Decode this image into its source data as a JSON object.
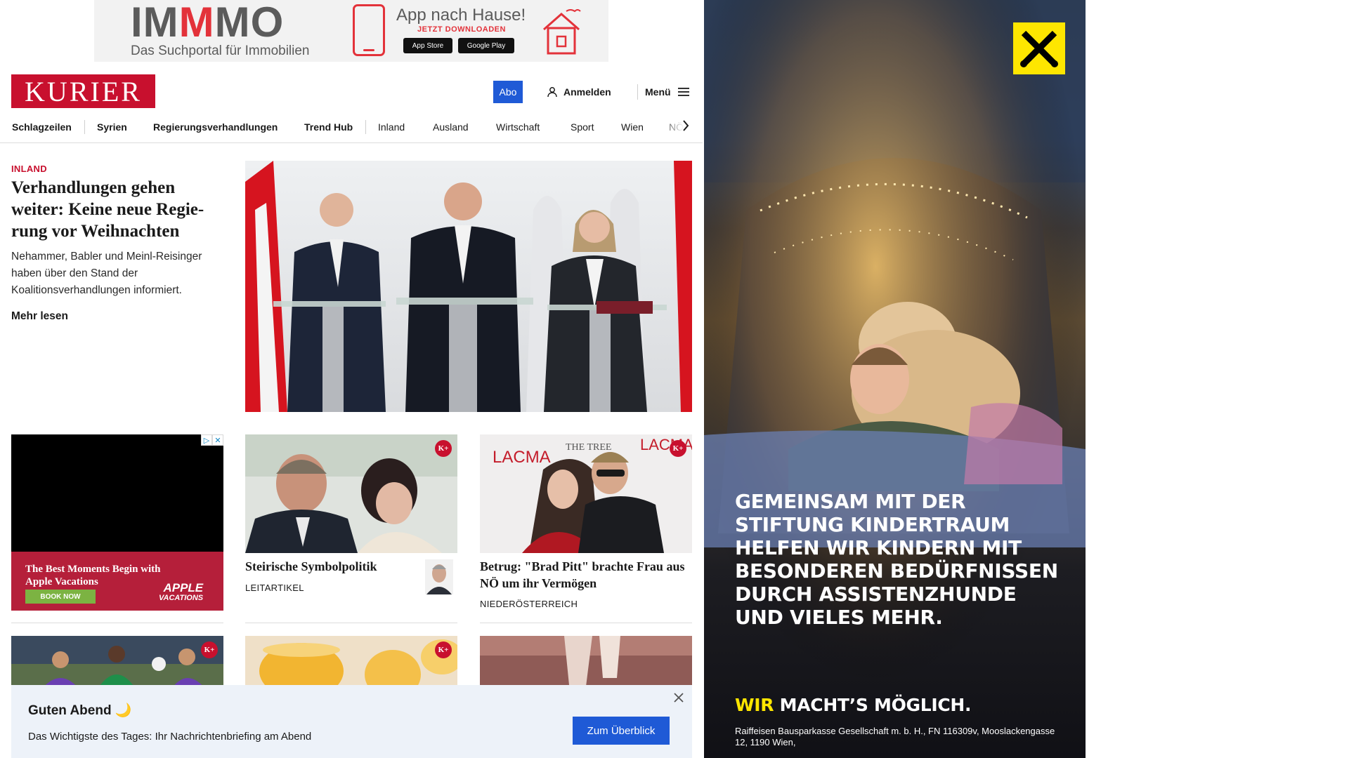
{
  "top_ad": {
    "brand_part1": "IM",
    "brand_part2": "M",
    "brand_part3": "MO",
    "subline": "Das Suchportal für Immobilien",
    "headline": "App nach Hause!",
    "cta": "JETZT DOWNLOADEN",
    "apple_store": "App Store",
    "google_play": "Google Play",
    "accent_color": "#e3323a"
  },
  "header": {
    "logo": "KURIER",
    "abo_label": "Abo",
    "login_label": "Anmelden",
    "menu_label": "Menü",
    "brand_color": "#c8102e",
    "button_color": "#1f5ad6"
  },
  "nav": {
    "items": [
      {
        "label": "Schlagzeilen"
      },
      {
        "label": "Syrien"
      },
      {
        "label": "Regierungsverhandlungen"
      },
      {
        "label": "Trend Hub"
      },
      {
        "label": "Inland"
      },
      {
        "label": "Ausland"
      },
      {
        "label": "Wirtschaft"
      },
      {
        "label": "Sport"
      },
      {
        "label": "Wien"
      },
      {
        "label": "NÖ"
      }
    ]
  },
  "lead": {
    "kicker": "INLAND",
    "title": "Verhandlungen gehen weiter: Keine neue Regie-rung vor Weihnachten",
    "teaser": "Nehammer, Babler und Meinl-Reisinger haben über den Stand der Koalitionsverhandlungen informiert.",
    "more": "Mehr lesen"
  },
  "apple_ad": {
    "headline": "The Best Moments Begin with Apple Vacations",
    "button": "BOOK NOW",
    "brand": "APPLE",
    "brand_sub": "VACATIONS"
  },
  "cards": [
    {
      "title": "Steirische Symbolpolitik",
      "kicker": "LEITARTIKEL",
      "premium": "K+"
    },
    {
      "title": "Betrug: \"Brad Pitt\" brachte Frau aus NÖ um ihr Vermögen",
      "kicker": "NIEDERÖSTERREICH",
      "premium": "K+"
    }
  ],
  "card_sign_lacma": "LACMA",
  "card_sign_tree": "THE TREE",
  "premium_badge": "K+",
  "side_ad": {
    "headline": "GEMEINSAM MIT DER STIFTUNG KINDERTRAUM HELFEN WIR KINDERN MIT BESONDEREN BEDÜRFNISSEN DURCH ASSISTENZHUNDE UND VIELES MEHR.",
    "claim_part1": "WIR",
    "claim_part2": "MACHT’S MÖGLICH.",
    "legal": "Raiffeisen Bausparkasse Gesellschaft m. b. H., FN 116309v, Mooslackengasse 12, 1190 Wien,",
    "accent_color": "#fee600"
  },
  "notification": {
    "title": "Guten Abend 🌙",
    "text": "Das Wichtigste des Tages: Ihr Nachrichtenbriefing am Abend",
    "button": "Zum Überblick"
  }
}
